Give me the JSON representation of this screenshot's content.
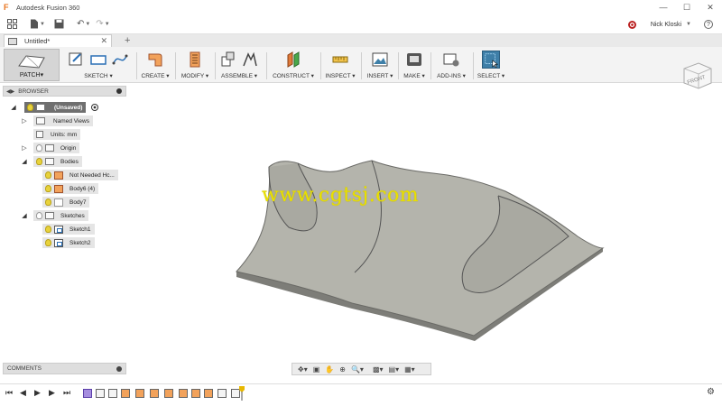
{
  "app": {
    "title": "Autodesk Fusion 360",
    "user": "Nick Kloski"
  },
  "tabs": [
    {
      "label": "Untitled*"
    }
  ],
  "toolbar": {
    "workspace": "PATCH",
    "groups": [
      {
        "label": "SKETCH"
      },
      {
        "label": "CREATE"
      },
      {
        "label": "MODIFY"
      },
      {
        "label": "ASSEMBLE"
      },
      {
        "label": "CONSTRUCT"
      },
      {
        "label": "INSPECT"
      },
      {
        "label": "INSERT"
      },
      {
        "label": "MAKE"
      },
      {
        "label": "ADD-INS"
      },
      {
        "label": "SELECT"
      }
    ]
  },
  "viewcube": {
    "face": "FRONT"
  },
  "browser": {
    "title": "BROWSER",
    "items": [
      {
        "label": "(Unsaved)"
      },
      {
        "label": "Named Views"
      },
      {
        "label": "Units: mm"
      },
      {
        "label": "Origin"
      },
      {
        "label": "Bodies"
      },
      {
        "label": "Not Needed Hc..."
      },
      {
        "label": "Body6 (4)"
      },
      {
        "label": "Body7"
      },
      {
        "label": "Sketches"
      },
      {
        "label": "Sketch1"
      },
      {
        "label": "Sketch2"
      }
    ]
  },
  "comments": {
    "title": "COMMENTS"
  },
  "watermark": "www.cgtsj.com",
  "colors": {
    "selected": "#3e7fa8",
    "body": "#b4b4ac",
    "bodyico": "#f2a25b"
  }
}
